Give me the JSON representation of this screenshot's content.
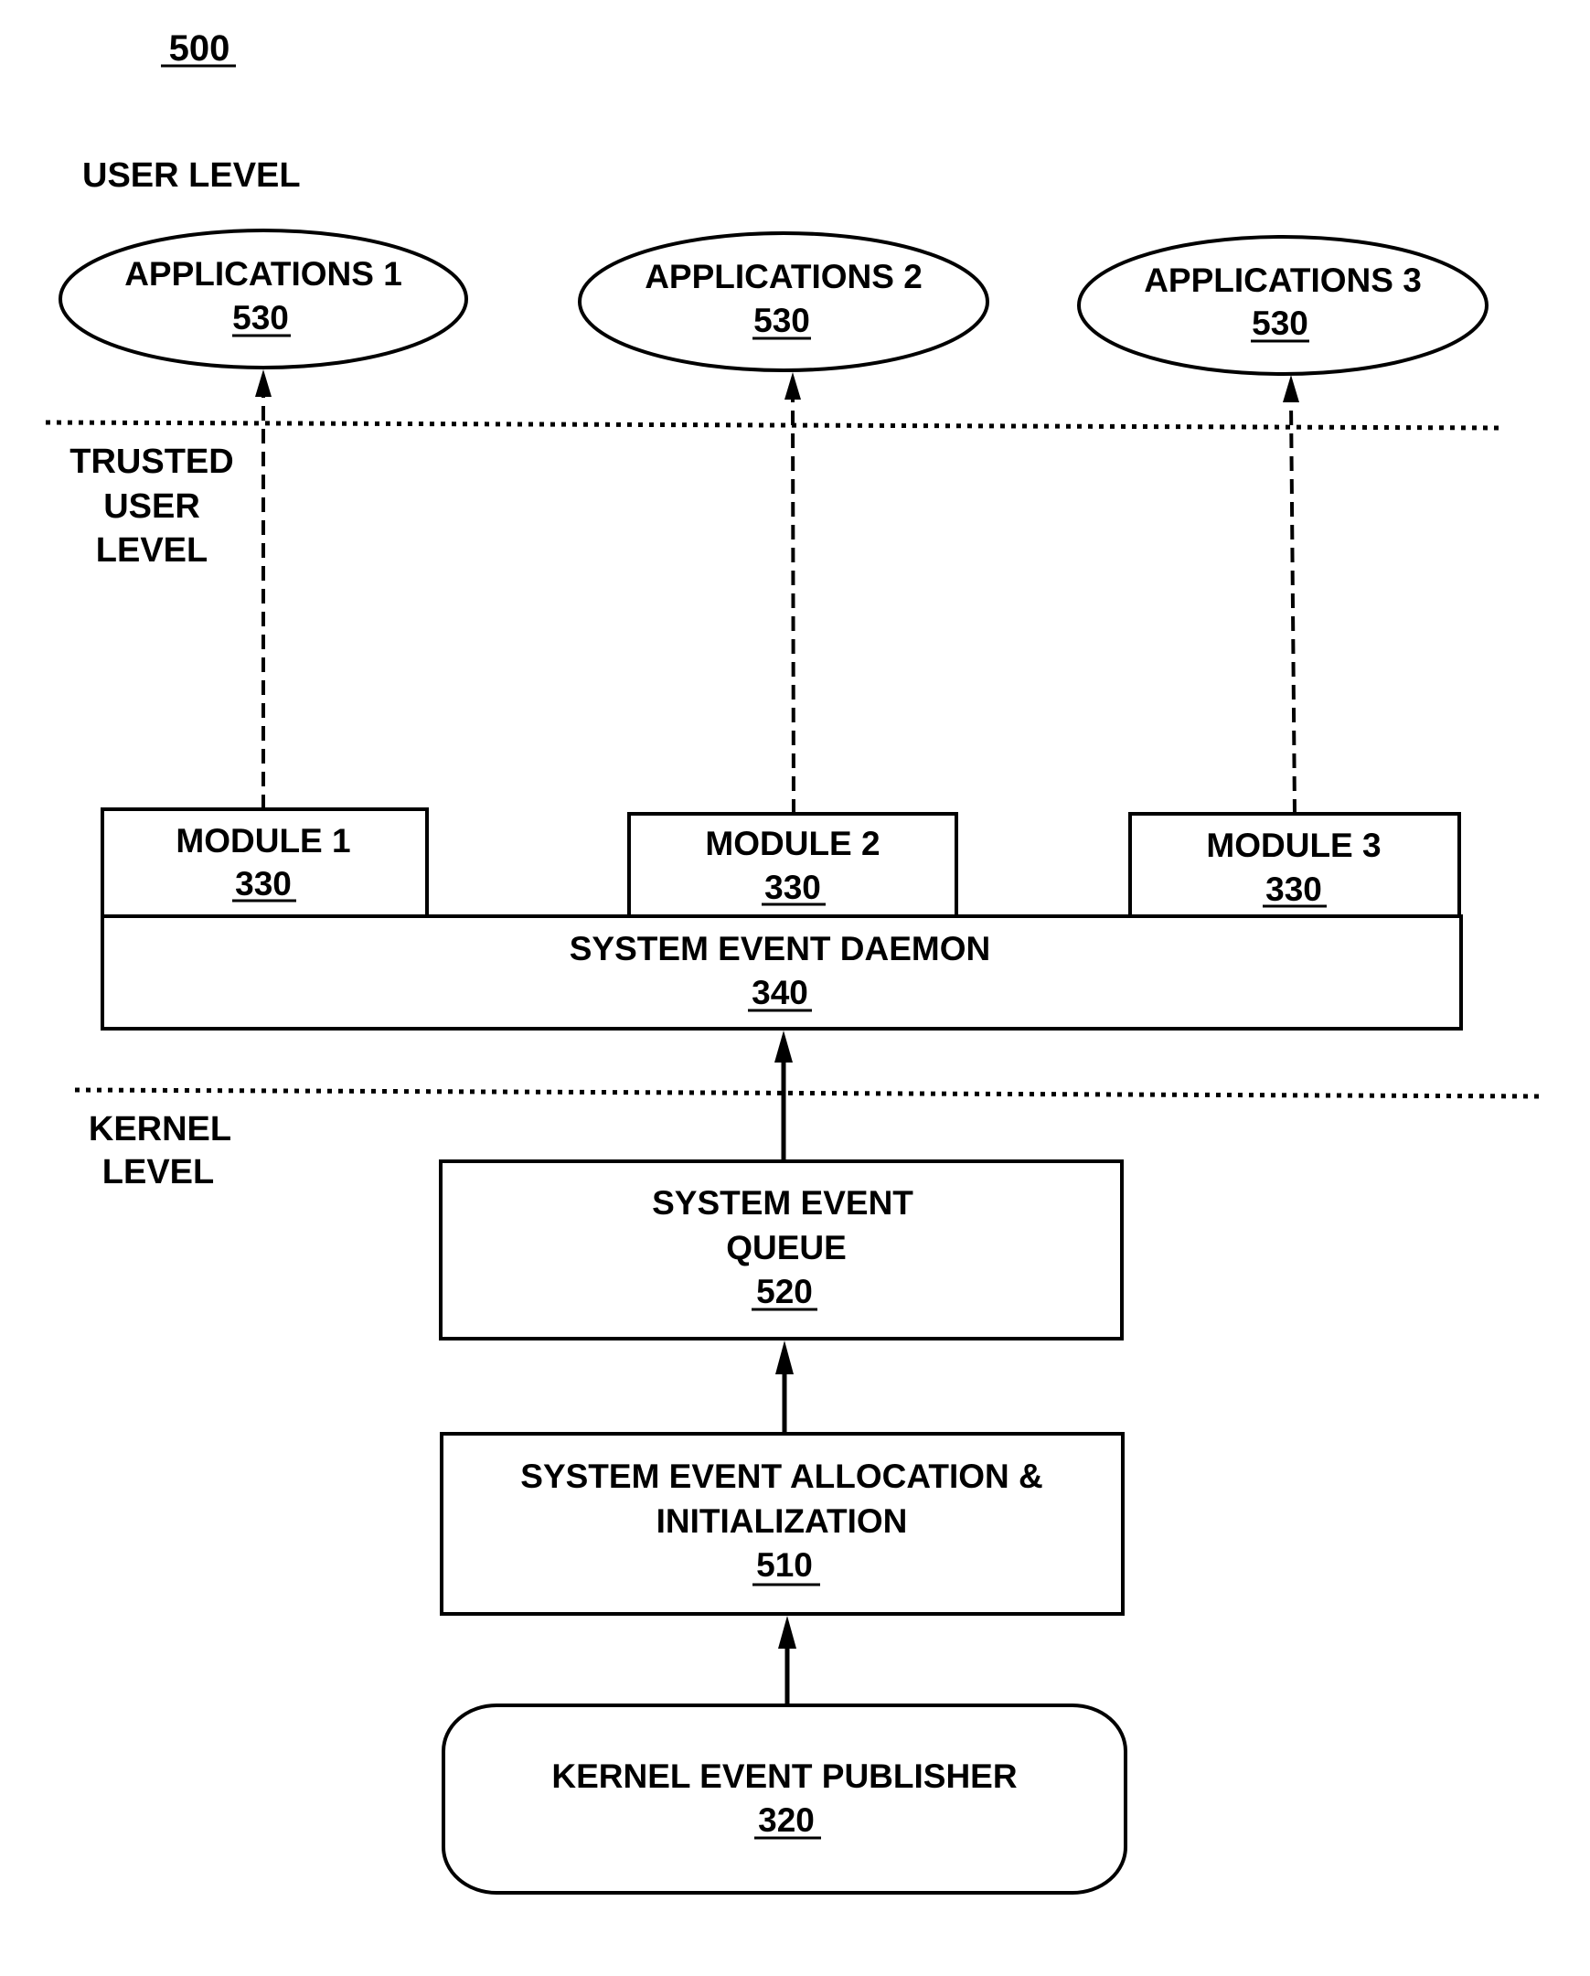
{
  "figure": {
    "number": "500"
  },
  "levels": {
    "user": "USER LEVEL",
    "trusted": [
      "TRUSTED",
      "USER",
      "LEVEL"
    ],
    "kernel": [
      "KERNEL",
      "LEVEL"
    ]
  },
  "applications": [
    {
      "label": "APPLICATIONS 1",
      "ref": "530"
    },
    {
      "label": "APPLICATIONS 2",
      "ref": "530"
    },
    {
      "label": "APPLICATIONS 3",
      "ref": "530"
    }
  ],
  "modules": [
    {
      "label": "MODULE 1",
      "ref": "330"
    },
    {
      "label": "MODULE 2",
      "ref": "330"
    },
    {
      "label": "MODULE 3",
      "ref": "330"
    }
  ],
  "daemon": {
    "label": "SYSTEM EVENT DAEMON",
    "ref": "340"
  },
  "queue": {
    "lines": [
      "SYSTEM EVENT",
      "QUEUE"
    ],
    "ref": "520"
  },
  "allocation": {
    "lines": [
      "SYSTEM EVENT ALLOCATION &",
      "INITIALIZATION"
    ],
    "ref": "510"
  },
  "publisher": {
    "label": "KERNEL EVENT PUBLISHER",
    "ref": "320"
  },
  "connections": [
    {
      "from": "KERNEL EVENT PUBLISHER",
      "to": "SYSTEM EVENT ALLOCATION & INITIALIZATION",
      "style": "solid"
    },
    {
      "from": "SYSTEM EVENT ALLOCATION & INITIALIZATION",
      "to": "SYSTEM EVENT QUEUE",
      "style": "solid"
    },
    {
      "from": "SYSTEM EVENT QUEUE",
      "to": "SYSTEM EVENT DAEMON",
      "style": "solid"
    },
    {
      "from": "MODULE 1",
      "to": "APPLICATIONS 1",
      "style": "dashed"
    },
    {
      "from": "MODULE 2",
      "to": "APPLICATIONS 2",
      "style": "dashed"
    },
    {
      "from": "MODULE 3",
      "to": "APPLICATIONS 3",
      "style": "dashed"
    }
  ]
}
